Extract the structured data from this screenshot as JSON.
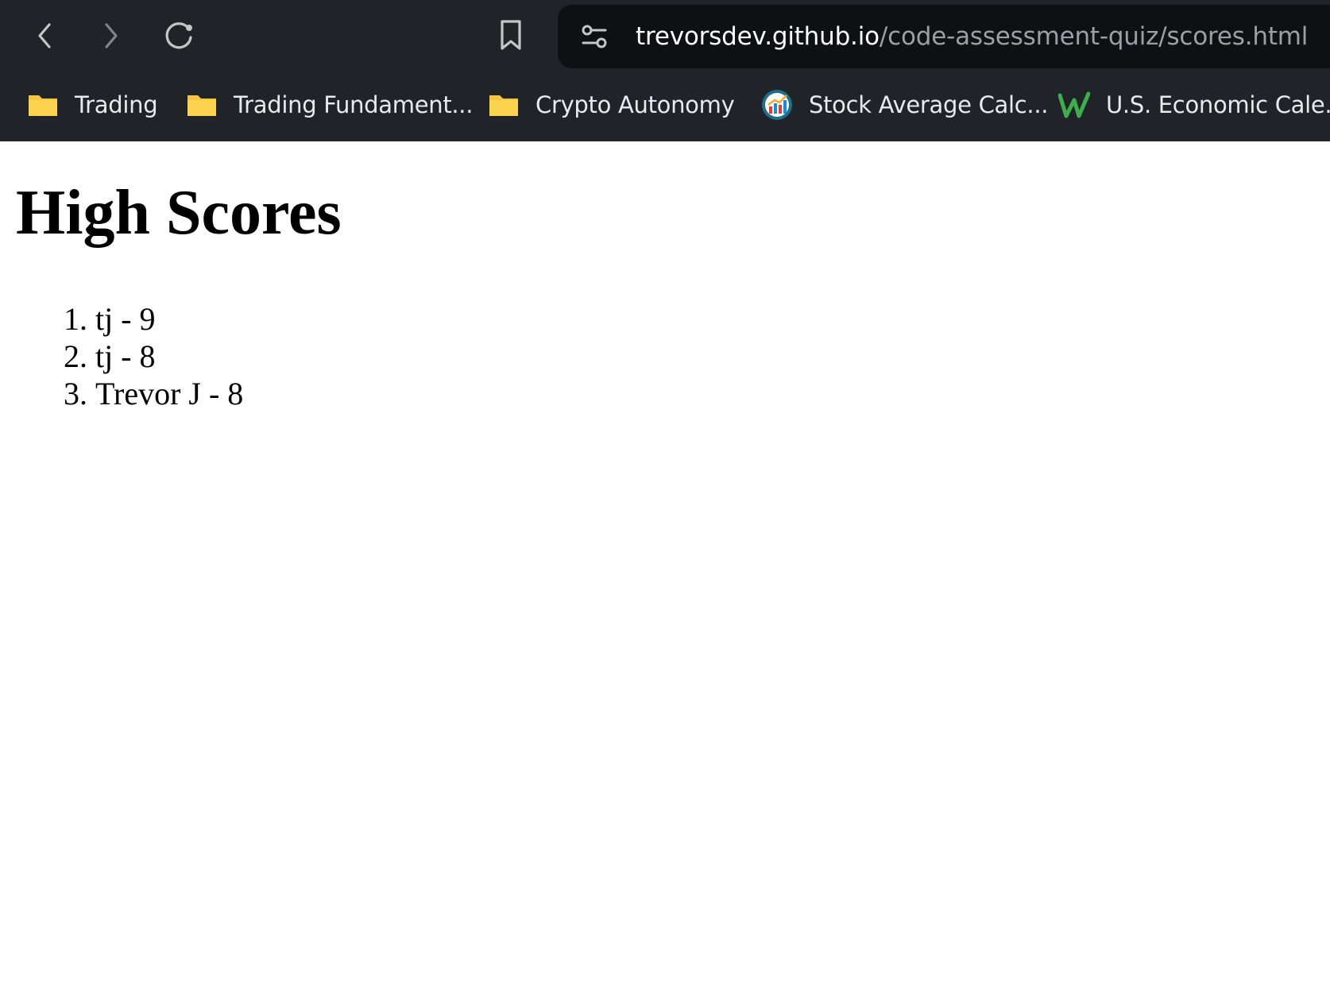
{
  "browser": {
    "url_host": "trevorsdev.github.io",
    "url_path": "/code-assessment-quiz/scores.html",
    "bookmarks": [
      {
        "label": "Trading",
        "icon": "folder-icon"
      },
      {
        "label": "Trading Fundament...",
        "icon": "folder-icon"
      },
      {
        "label": "Crypto Autonomy",
        "icon": "folder-icon"
      },
      {
        "label": "Stock Average Calc...",
        "icon": "chart-favicon-icon"
      },
      {
        "label": "U.S. Economic Cale...",
        "icon": "w-favicon-icon"
      }
    ]
  },
  "page": {
    "title": "High Scores",
    "scores": [
      {
        "entry": "tj - 9"
      },
      {
        "entry": "tj - 8"
      },
      {
        "entry": "Trevor J - 8"
      }
    ]
  },
  "colors": {
    "chrome_bg": "#202428",
    "address_bg": "#0e1013",
    "url_host": "#ffffff",
    "url_path": "#9aa0a6",
    "folder": "#f5c542",
    "w_favicon": "#3dae49"
  }
}
